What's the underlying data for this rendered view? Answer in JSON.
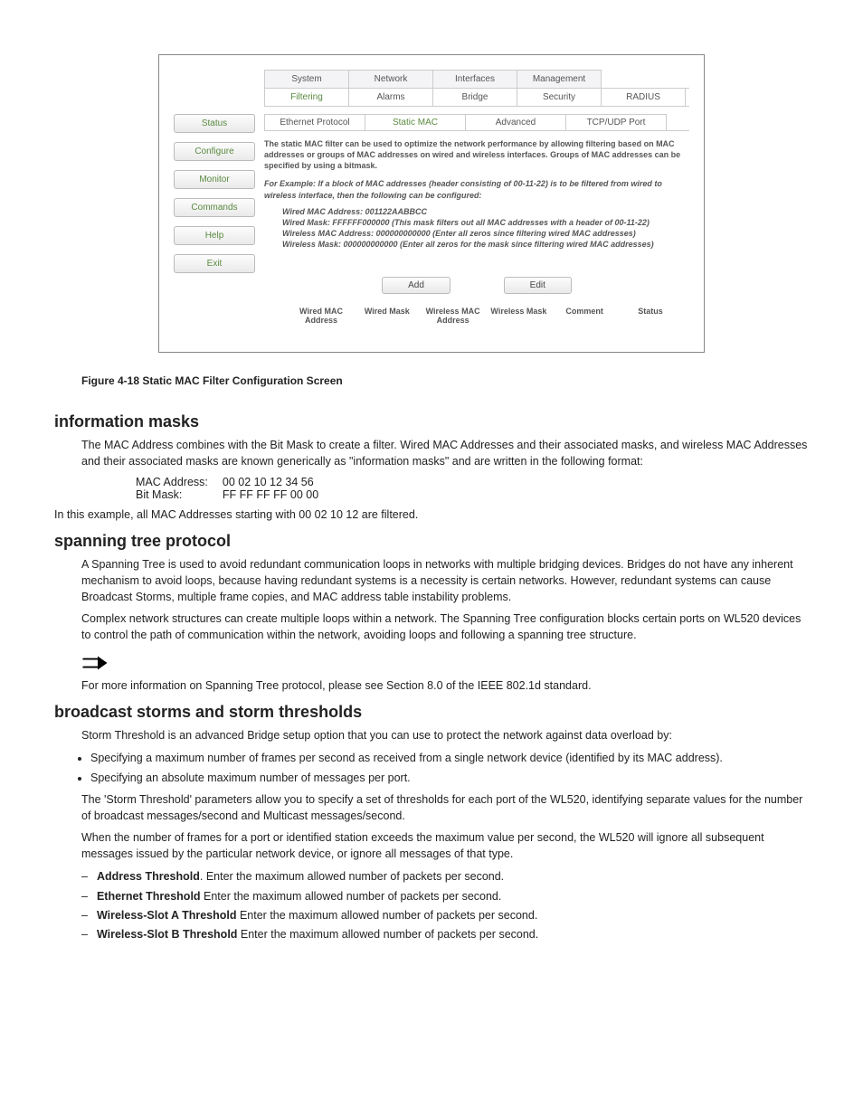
{
  "screenshot": {
    "top_tabs": [
      "System",
      "Network",
      "Interfaces",
      "Management"
    ],
    "sub_tabs": [
      "Filtering",
      "Alarms",
      "Bridge",
      "Security",
      "RADIUS"
    ],
    "sub_tabs_selected": 0,
    "side_nav": [
      "Status",
      "Configure",
      "Monitor",
      "Commands",
      "Help",
      "Exit"
    ],
    "side_nav_selected": 1,
    "subsub_tabs": [
      "Ethernet Protocol",
      "Static MAC",
      "Advanced",
      "TCP/UDP Port"
    ],
    "subsub_selected": 1,
    "desc_main": "The static MAC filter can be used to optimize the network performance by allowing filtering based on MAC addresses or groups of MAC addresses on wired and wireless interfaces. Groups of MAC addresses can be specified by using a bitmask.",
    "desc_example_lead": "For Example: If a block of MAC addresses (header consisting of 00-11-22) is to be filtered from wired to wireless interface, then the following can be configured:",
    "desc_lines": [
      "Wired MAC Address: 001122AABBCC",
      "Wired Mask: FFFFFF000000 (This mask filters out all MAC addresses with a header of 00-11-22)",
      "Wireless MAC Address: 000000000000 (Enter all zeros since filtering wired MAC addresses)",
      "Wireless Mask: 000000000000 (Enter all zeros for the mask since filtering wired MAC addresses)"
    ],
    "buttons": {
      "add": "Add",
      "edit": "Edit"
    },
    "columns": [
      "Wired MAC Address",
      "Wired Mask",
      "Wireless MAC Address",
      "Wireless Mask",
      "Comment",
      "Status"
    ]
  },
  "figure_caption": "Figure 4-18    Static MAC Filter Configuration Screen",
  "sections": {
    "info_masks": {
      "title": "information masks",
      "para1": "The MAC Address combines with the Bit Mask to create a filter. Wired MAC Addresses and their associated masks, and wireless MAC Addresses and their associated masks are known generically as \"information masks\" and are written in the following format:",
      "mac_label": "MAC Address:",
      "mac_value": "00 02 10 12 34 56",
      "mask_label": "Bit Mask:",
      "mask_value": "FF FF FF FF 00 00",
      "para2": "In this example, all MAC Addresses starting with 00 02 10 12 are filtered."
    },
    "spanning": {
      "title": "spanning tree protocol",
      "para1": "A Spanning Tree is used to avoid redundant communication loops in networks with multiple bridging devices. Bridges do not have any inherent mechanism to avoid loops, because having redundant systems is a necessity is certain networks. However, redundant systems can cause Broadcast Storms, multiple frame copies, and MAC address table instability problems.",
      "para2": "Complex network structures can create multiple loops within a network. The Spanning Tree configuration blocks certain ports on WL520 devices to control the path of communication within the network, avoiding loops and following a spanning tree structure.",
      "note": "For more information on Spanning Tree protocol, please see Section 8.0 of the IEEE 802.1d standard."
    },
    "storms": {
      "title": "broadcast storms and storm thresholds",
      "para1": "Storm Threshold is an advanced Bridge setup option that you can use to protect the network against data overload by:",
      "bullets": [
        "Specifying a maximum number of frames per second as received from a single network device (identified by its MAC address).",
        "Specifying an absolute maximum number of messages per port."
      ],
      "para2": "The 'Storm Threshold' parameters allow you to specify a set of thresholds for each port of the WL520, identifying separate values for the number of broadcast messages/second and Multicast messages/second.",
      "para3": "When the number of frames for a port or identified station exceeds the maximum value per second, the WL520 will ignore all subsequent messages issued by the particular network device, or ignore all messages of that type.",
      "dashes": [
        {
          "term": "Address Threshold",
          "rest": ". Enter the maximum allowed number of packets per second."
        },
        {
          "term": "Ethernet Threshold",
          "rest": " Enter the maximum allowed number of packets per second."
        },
        {
          "term": "Wireless-Slot A Threshold",
          "rest": " Enter the maximum allowed number of packets per second."
        },
        {
          "term": "Wireless-Slot B Threshold",
          "rest": " Enter the maximum allowed number of packets per second."
        }
      ]
    }
  }
}
